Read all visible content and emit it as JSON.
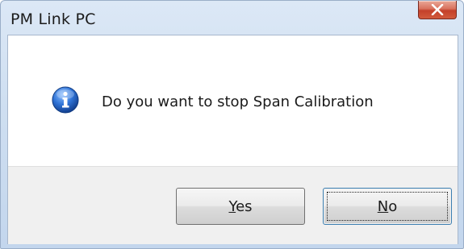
{
  "window": {
    "title": "PM Link PC",
    "close_label": "Close"
  },
  "dialog": {
    "icon": "info-icon",
    "message": "Do you want to stop Span Calibration"
  },
  "buttons": {
    "yes": {
      "mnemonic": "Y",
      "rest": "es"
    },
    "no": {
      "mnemonic": "N",
      "rest": "o"
    }
  },
  "colors": {
    "titlebar": "#cfdff1",
    "close_button": "#c4402a",
    "button_area": "#f0f0f0",
    "info_icon": "#1f5fbf"
  }
}
